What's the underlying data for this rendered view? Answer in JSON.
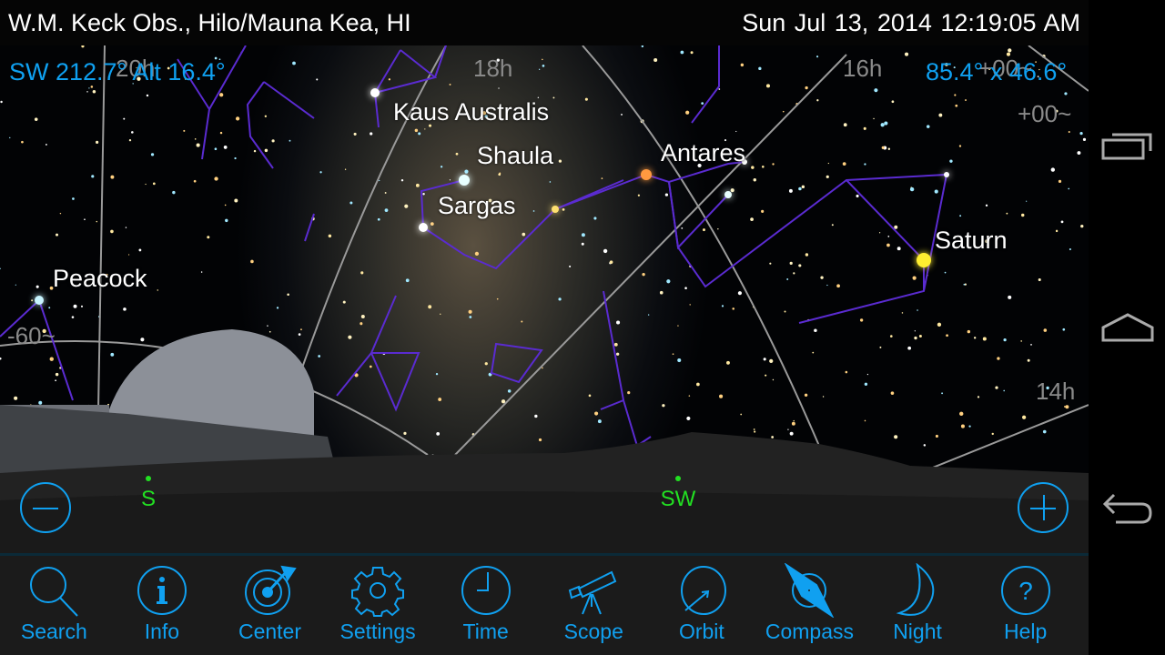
{
  "header": {
    "location": "W.M. Keck Obs., Hilo/Mauna Kea, HI",
    "datetime": "Sun Jul 13, 2014  12:19:05 AM"
  },
  "hud": {
    "pointing": "SW 212.7° Alt 16.4°",
    "field_of_view": "85.4° x 46.6°"
  },
  "grid_labels": [
    "20h",
    "18h",
    "16h",
    "+00~",
    "+00~",
    "-60~",
    "14h"
  ],
  "star_labels": [
    "Kaus Australis",
    "Shaula",
    "Antares",
    "Sargas",
    "Saturn",
    "Peacock"
  ],
  "directions": [
    "S",
    "SW"
  ],
  "toolbar": [
    {
      "label": "Search",
      "icon": "search-icon"
    },
    {
      "label": "Info",
      "icon": "info-icon"
    },
    {
      "label": "Center",
      "icon": "target-icon"
    },
    {
      "label": "Settings",
      "icon": "gear-icon"
    },
    {
      "label": "Time",
      "icon": "clock-icon"
    },
    {
      "label": "Scope",
      "icon": "telescope-icon"
    },
    {
      "label": "Orbit",
      "icon": "orbit-icon"
    },
    {
      "label": "Compass",
      "icon": "compass-icon"
    },
    {
      "label": "Night",
      "icon": "moon-icon"
    },
    {
      "label": "Help",
      "icon": "help-icon"
    }
  ],
  "colors": {
    "accent": "#10a0f0",
    "direction": "#22e022",
    "constellation": "#5a2bd0"
  }
}
